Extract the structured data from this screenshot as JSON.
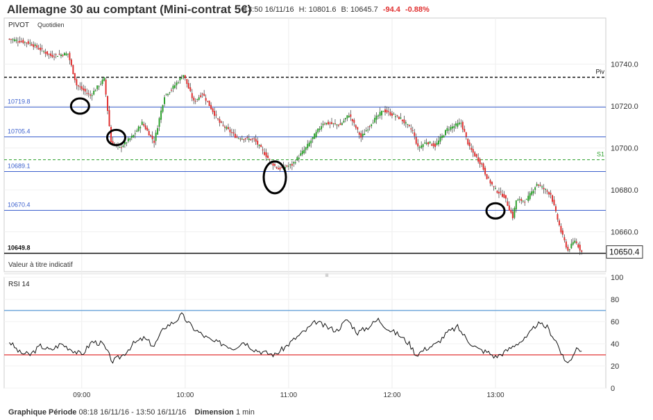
{
  "header": {
    "title": "Allemagne 30 au comptant (Mini-contrat 5€)",
    "time": "13:50 16/11/16",
    "high": "H: 10801.6",
    "low": "B: 10645.7",
    "change": "-94.4",
    "change_pct": "-0.88%"
  },
  "panel": {
    "label": "PIVOT",
    "period": "Quotidien",
    "disclaimer": "Valeur à titre indicatif",
    "resize_handle": "≡"
  },
  "footer": {
    "period_label": "Graphique Période",
    "period_value": "08:18 16/11/16 - 13:50 16/11/16",
    "dimension_label": "Dimension",
    "dimension_value": "1 min"
  },
  "colors": {
    "up": "#2ca02c",
    "down": "#e03030",
    "level": "#3a5fcd",
    "s1": "#2ca02c",
    "rsi": "#111111",
    "rsi_upper": "#5b9bd5",
    "rsi_lower": "#e03030"
  },
  "chart_data": [
    {
      "type": "candlestick",
      "title": "Allemagne 30 au comptant (Mini-contrat 5€)",
      "x_ticks": [
        "09:00",
        "10:00",
        "11:00",
        "12:00",
        "13:00"
      ],
      "x_range": [
        "08:18",
        "13:50"
      ],
      "y_ticks": [
        10740.0,
        10720.0,
        10700.0,
        10680.0,
        10660.0
      ],
      "ylim": [
        10641,
        10762
      ],
      "last_price": 10650.4,
      "levels": [
        {
          "name": "Piv",
          "value": 10734.0,
          "style": "dashed-black",
          "label_side": "right"
        },
        {
          "name": "10719.8",
          "value": 10719.8,
          "style": "solid-blue",
          "label_side": "left"
        },
        {
          "name": "10705.4",
          "value": 10705.4,
          "style": "solid-blue",
          "label_side": "left"
        },
        {
          "name": "S1",
          "value": 10694.6,
          "style": "dashed-green",
          "label_side": "right"
        },
        {
          "name": "10689.1",
          "value": 10689.1,
          "style": "solid-blue",
          "label_side": "left"
        },
        {
          "name": "10670.4",
          "value": 10670.4,
          "style": "solid-blue",
          "label_side": "left"
        },
        {
          "name": "10649.8",
          "value": 10649.8,
          "style": "solid-black",
          "label_side": "left"
        }
      ],
      "annotations": [
        {
          "shape": "ellipse",
          "time": "08:59",
          "value": 10720
        },
        {
          "shape": "ellipse",
          "time": "09:20",
          "value": 10705
        },
        {
          "shape": "ellipse",
          "time": "10:52",
          "value": 10686
        },
        {
          "shape": "ellipse",
          "time": "13:00",
          "value": 10670
        }
      ],
      "price_path": [
        {
          "t": "08:18",
          "v": 10752
        },
        {
          "t": "08:30",
          "v": 10750
        },
        {
          "t": "08:42",
          "v": 10744
        },
        {
          "t": "08:52",
          "v": 10745
        },
        {
          "t": "08:57",
          "v": 10730
        },
        {
          "t": "09:05",
          "v": 10725
        },
        {
          "t": "09:13",
          "v": 10733
        },
        {
          "t": "09:17",
          "v": 10703
        },
        {
          "t": "09:22",
          "v": 10700
        },
        {
          "t": "09:30",
          "v": 10706
        },
        {
          "t": "09:35",
          "v": 10712
        },
        {
          "t": "09:42",
          "v": 10703
        },
        {
          "t": "09:48",
          "v": 10725
        },
        {
          "t": "09:52",
          "v": 10728
        },
        {
          "t": "09:59",
          "v": 10735
        },
        {
          "t": "10:05",
          "v": 10722
        },
        {
          "t": "10:10",
          "v": 10726
        },
        {
          "t": "10:20",
          "v": 10712
        },
        {
          "t": "10:30",
          "v": 10705
        },
        {
          "t": "10:40",
          "v": 10704
        },
        {
          "t": "10:50",
          "v": 10693
        },
        {
          "t": "10:54",
          "v": 10690
        },
        {
          "t": "11:02",
          "v": 10692
        },
        {
          "t": "11:10",
          "v": 10700
        },
        {
          "t": "11:20",
          "v": 10712
        },
        {
          "t": "11:30",
          "v": 10711
        },
        {
          "t": "11:35",
          "v": 10716
        },
        {
          "t": "11:42",
          "v": 10705
        },
        {
          "t": "11:48",
          "v": 10712
        },
        {
          "t": "11:55",
          "v": 10718
        },
        {
          "t": "12:05",
          "v": 10714
        },
        {
          "t": "12:12",
          "v": 10708
        },
        {
          "t": "12:15",
          "v": 10700
        },
        {
          "t": "12:20",
          "v": 10703
        },
        {
          "t": "12:25",
          "v": 10701
        },
        {
          "t": "12:32",
          "v": 10709
        },
        {
          "t": "12:40",
          "v": 10712
        },
        {
          "t": "12:45",
          "v": 10700
        },
        {
          "t": "12:52",
          "v": 10692
        },
        {
          "t": "12:55",
          "v": 10686
        },
        {
          "t": "13:00",
          "v": 10680
        },
        {
          "t": "13:05",
          "v": 10677
        },
        {
          "t": "13:10",
          "v": 10667
        },
        {
          "t": "13:12",
          "v": 10675
        },
        {
          "t": "13:18",
          "v": 10675
        },
        {
          "t": "13:24",
          "v": 10683
        },
        {
          "t": "13:32",
          "v": 10678
        },
        {
          "t": "13:38",
          "v": 10660
        },
        {
          "t": "13:42",
          "v": 10651
        },
        {
          "t": "13:46",
          "v": 10656
        },
        {
          "t": "13:50",
          "v": 10650.4
        }
      ]
    },
    {
      "type": "line",
      "title": "RSI 14",
      "x_ticks": [
        "09:00",
        "10:00",
        "11:00",
        "12:00",
        "13:00"
      ],
      "y_ticks": [
        100,
        80,
        60,
        40,
        20,
        0
      ],
      "ylim": [
        0,
        100
      ],
      "reference_lines": [
        70,
        30
      ],
      "series": [
        {
          "name": "RSI 14",
          "points": [
            {
              "t": "08:18",
              "v": 42
            },
            {
              "t": "08:24",
              "v": 32
            },
            {
              "t": "08:30",
              "v": 30
            },
            {
              "t": "08:36",
              "v": 38
            },
            {
              "t": "08:42",
              "v": 34
            },
            {
              "t": "08:48",
              "v": 40
            },
            {
              "t": "08:54",
              "v": 35
            },
            {
              "t": "09:00",
              "v": 30
            },
            {
              "t": "09:06",
              "v": 42
            },
            {
              "t": "09:12",
              "v": 40
            },
            {
              "t": "09:18",
              "v": 24
            },
            {
              "t": "09:24",
              "v": 30
            },
            {
              "t": "09:30",
              "v": 40
            },
            {
              "t": "09:36",
              "v": 45
            },
            {
              "t": "09:42",
              "v": 38
            },
            {
              "t": "09:48",
              "v": 55
            },
            {
              "t": "09:54",
              "v": 60
            },
            {
              "t": "09:58",
              "v": 66
            },
            {
              "t": "10:04",
              "v": 55
            },
            {
              "t": "10:10",
              "v": 48
            },
            {
              "t": "10:16",
              "v": 42
            },
            {
              "t": "10:22",
              "v": 40
            },
            {
              "t": "10:28",
              "v": 36
            },
            {
              "t": "10:34",
              "v": 42
            },
            {
              "t": "10:40",
              "v": 35
            },
            {
              "t": "10:46",
              "v": 32
            },
            {
              "t": "10:52",
              "v": 30
            },
            {
              "t": "10:58",
              "v": 37
            },
            {
              "t": "11:04",
              "v": 45
            },
            {
              "t": "11:10",
              "v": 52
            },
            {
              "t": "11:16",
              "v": 60
            },
            {
              "t": "11:22",
              "v": 55
            },
            {
              "t": "11:28",
              "v": 52
            },
            {
              "t": "11:34",
              "v": 62
            },
            {
              "t": "11:40",
              "v": 50
            },
            {
              "t": "11:46",
              "v": 55
            },
            {
              "t": "11:52",
              "v": 62
            },
            {
              "t": "11:58",
              "v": 53
            },
            {
              "t": "12:04",
              "v": 48
            },
            {
              "t": "12:10",
              "v": 40
            },
            {
              "t": "12:14",
              "v": 30
            },
            {
              "t": "12:20",
              "v": 36
            },
            {
              "t": "12:26",
              "v": 40
            },
            {
              "t": "12:32",
              "v": 50
            },
            {
              "t": "12:38",
              "v": 55
            },
            {
              "t": "12:44",
              "v": 43
            },
            {
              "t": "12:50",
              "v": 35
            },
            {
              "t": "12:56",
              "v": 32
            },
            {
              "t": "13:00",
              "v": 28
            },
            {
              "t": "13:06",
              "v": 33
            },
            {
              "t": "13:12",
              "v": 40
            },
            {
              "t": "13:18",
              "v": 45
            },
            {
              "t": "13:24",
              "v": 58
            },
            {
              "t": "13:30",
              "v": 55
            },
            {
              "t": "13:36",
              "v": 40
            },
            {
              "t": "13:40",
              "v": 24
            },
            {
              "t": "13:44",
              "v": 25
            },
            {
              "t": "13:47",
              "v": 38
            },
            {
              "t": "13:50",
              "v": 33
            }
          ]
        }
      ]
    }
  ]
}
